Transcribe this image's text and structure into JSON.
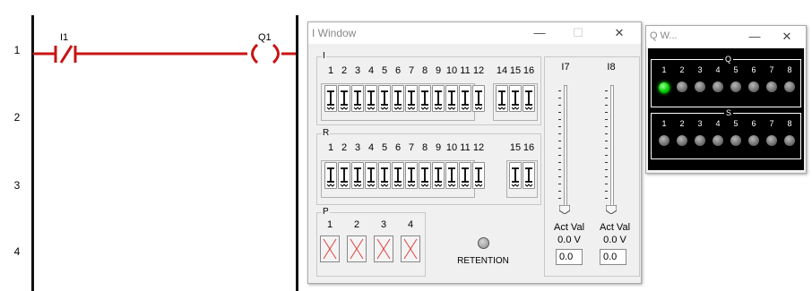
{
  "ladder": {
    "rung_numbers": [
      "1",
      "2",
      "3",
      "4"
    ],
    "contact_tag": "I1",
    "coil_tag": "Q1",
    "wire_color": "#c81414"
  },
  "i_window": {
    "title": "I Window",
    "minimize": "—",
    "maximize": "☐",
    "close": "✕",
    "i_group": {
      "label": "I",
      "numbers": [
        "1",
        "2",
        "3",
        "4",
        "5",
        "6",
        "7",
        "8",
        "9",
        "10",
        "11",
        "12",
        "14",
        "15",
        "16"
      ]
    },
    "r_group": {
      "label": "R",
      "numbers": [
        "1",
        "2",
        "3",
        "4",
        "5",
        "6",
        "7",
        "8",
        "9",
        "10",
        "11",
        "12",
        "15",
        "16"
      ]
    },
    "p_group": {
      "label": "P",
      "numbers": [
        "1",
        "2",
        "3",
        "4"
      ]
    },
    "retention_label": "RETENTION",
    "sliders": [
      {
        "label": "I7",
        "act_label": "Act Val",
        "act_value": "0.0 V",
        "input_value": "0.0"
      },
      {
        "label": "I8",
        "act_label": "Act Val",
        "act_value": "0.0 V",
        "input_value": "0.0"
      }
    ]
  },
  "q_window": {
    "title": "Q W...",
    "minimize": "—",
    "close": "✕",
    "q_group": {
      "label": "Q",
      "numbers": [
        "1",
        "2",
        "3",
        "4",
        "5",
        "6",
        "7",
        "8"
      ],
      "active": [
        true,
        false,
        false,
        false,
        false,
        false,
        false,
        false
      ]
    },
    "s_group": {
      "label": "S",
      "numbers": [
        "1",
        "2",
        "3",
        "4",
        "5",
        "6",
        "7",
        "8"
      ]
    },
    "on_color": "#00d000"
  }
}
